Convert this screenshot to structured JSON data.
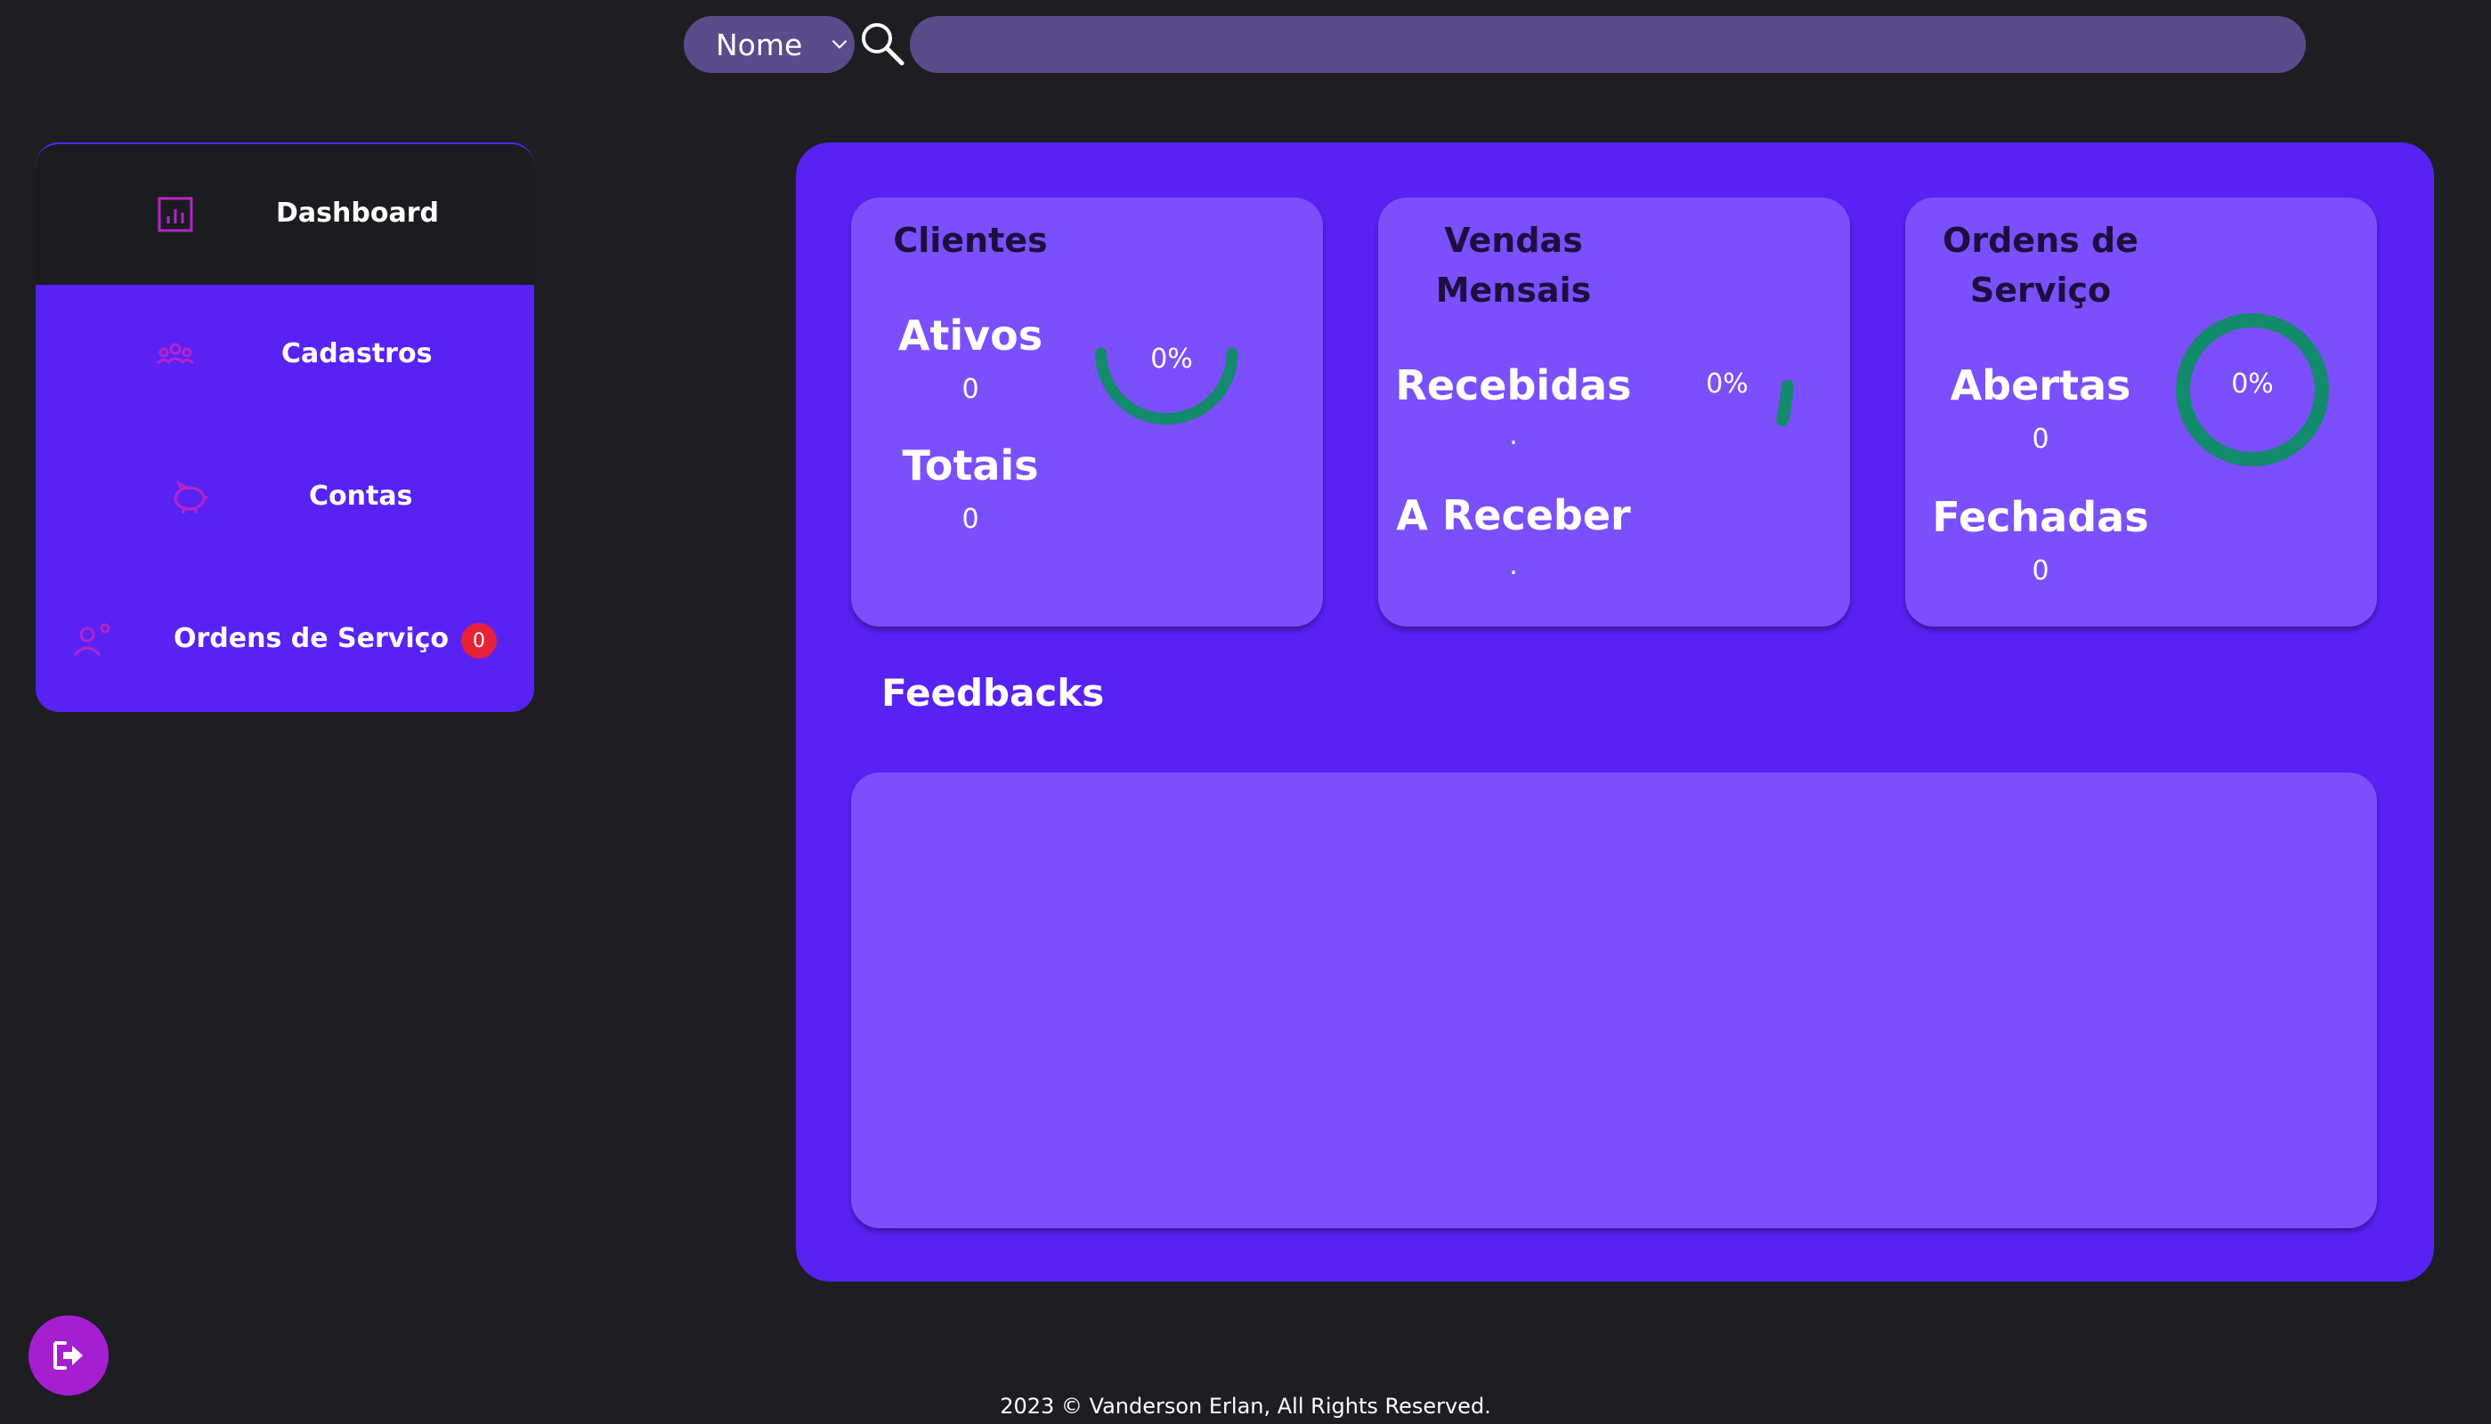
{
  "search": {
    "filter_selected": "Nome",
    "placeholder": "",
    "value": ""
  },
  "sidebar": {
    "items": [
      {
        "label": "Dashboard",
        "icon": "chart-icon"
      },
      {
        "label": "Cadastros",
        "icon": "users-icon"
      },
      {
        "label": "Contas",
        "icon": "piggy-bank-icon"
      },
      {
        "label": "Ordens de Serviço",
        "icon": "user-service-icon",
        "badge": "0"
      }
    ]
  },
  "cards": {
    "clientes": {
      "title": "Clientes",
      "ativos_label": "Ativos",
      "ativos_value": "0",
      "totais_label": "Totais",
      "totais_value": "0",
      "percent": "0%"
    },
    "vendas": {
      "title_line1": "Vendas",
      "title_line2": "Mensais",
      "recebidas_label": "Recebidas",
      "recebidas_value": ".",
      "areceber_label": "A Receber",
      "areceber_value": ".",
      "percent": "0%"
    },
    "ordens": {
      "title_line1": "Ordens de",
      "title_line2": "Serviço",
      "abertas_label": "Abertas",
      "abertas_value": "0",
      "fechadas_label": "Fechadas",
      "fechadas_value": "0",
      "percent": "0%"
    }
  },
  "feedbacks": {
    "title": "Feedbacks"
  },
  "footer": {
    "text": "2023 © Vanderson Erlan, All Rights Reserved."
  },
  "colors": {
    "background": "#1d1e22",
    "accent": "#5822f5",
    "card": "#7b4ffb",
    "gauge": "#128a6c",
    "badge": "#e8213a",
    "logout": "#a51fd0",
    "icon": "#b624c9"
  }
}
